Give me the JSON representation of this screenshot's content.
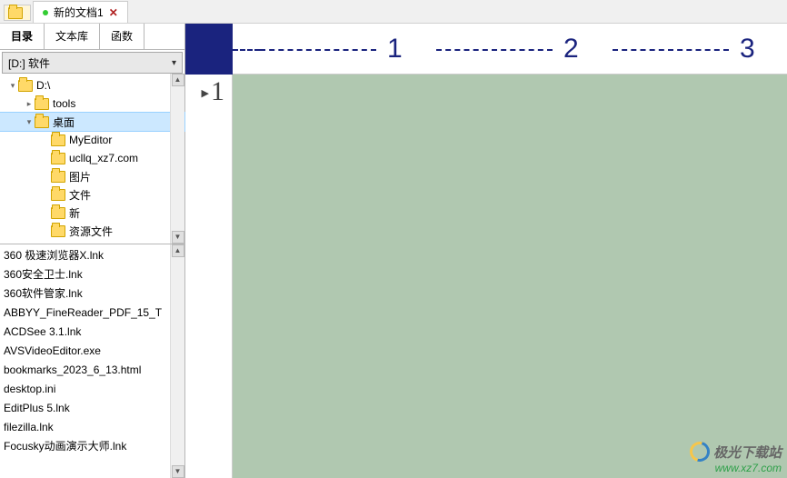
{
  "document_tab": {
    "title": "新的文档1",
    "close_glyph": "✕"
  },
  "sidebar": {
    "tabs": [
      {
        "label": "目录",
        "active": true
      },
      {
        "label": "文本库",
        "active": false
      },
      {
        "label": "函数",
        "active": false
      }
    ],
    "drive_selected": "[D:] 软件",
    "tree": [
      {
        "label": "D:\\",
        "depth": 0,
        "expandable": true,
        "expanded": true,
        "selected": false
      },
      {
        "label": "tools",
        "depth": 1,
        "expandable": true,
        "expanded": false,
        "selected": false
      },
      {
        "label": "桌面",
        "depth": 1,
        "expandable": true,
        "expanded": true,
        "selected": true
      },
      {
        "label": "MyEditor",
        "depth": 2,
        "expandable": false,
        "expanded": false,
        "selected": false
      },
      {
        "label": "ucllq_xz7.com",
        "depth": 2,
        "expandable": false,
        "expanded": false,
        "selected": false
      },
      {
        "label": "图片",
        "depth": 2,
        "expandable": false,
        "expanded": false,
        "selected": false
      },
      {
        "label": "文件",
        "depth": 2,
        "expandable": false,
        "expanded": false,
        "selected": false
      },
      {
        "label": "新",
        "depth": 2,
        "expandable": false,
        "expanded": false,
        "selected": false
      },
      {
        "label": "资源文件",
        "depth": 2,
        "expandable": false,
        "expanded": false,
        "selected": false
      }
    ],
    "files": [
      "360 极速浏览器X.lnk",
      "360安全卫士.lnk",
      "360软件管家.lnk",
      "ABBYY_FineReader_PDF_15_T",
      "ACDSee 3.1.lnk",
      "AVSVideoEditor.exe",
      "bookmarks_2023_6_13.html",
      "desktop.ini",
      "EditPlus 5.lnk",
      "filezilla.lnk",
      "Focusky动画演示大师.lnk"
    ]
  },
  "editor": {
    "ruler_numbers": [
      "1",
      "2",
      "3"
    ],
    "line_numbers": [
      "1"
    ]
  },
  "watermark": {
    "name_cn": "极光下载站",
    "url": "www.xz7.com"
  }
}
